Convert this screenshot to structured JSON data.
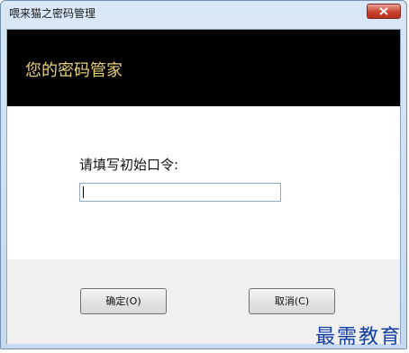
{
  "window": {
    "title": "喂来猫之密码管理"
  },
  "banner": {
    "heading": "您的密码管家"
  },
  "form": {
    "prompt_label": "请填写初始口令:",
    "password_value": ""
  },
  "buttons": {
    "ok_label": "确定(O)",
    "cancel_label": "取消(C)"
  },
  "watermark": {
    "text": "最需教育"
  },
  "colors": {
    "banner_bg": "#000000",
    "banner_text": "#e8d07a",
    "close_button": "#c8422f",
    "watermark": "#123ea4"
  },
  "icons": {
    "close": "close-x-icon"
  }
}
